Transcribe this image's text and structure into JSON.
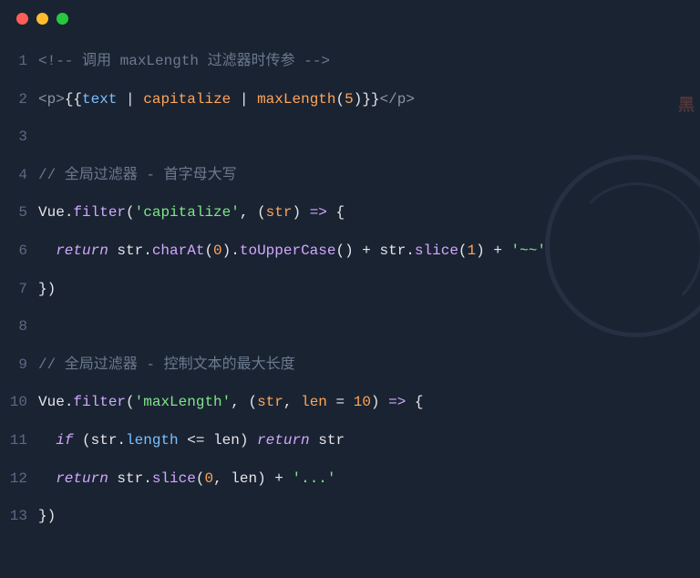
{
  "window": {
    "controls": [
      "close",
      "minimize",
      "maximize"
    ]
  },
  "code": {
    "lines": [
      {
        "n": "1",
        "tokens": [
          {
            "t": "comment",
            "v": "<!-- 调用 maxLength 过滤器时传参 -->"
          }
        ]
      },
      {
        "n": "2",
        "tokens": [
          {
            "t": "tag",
            "v": "<"
          },
          {
            "t": "tag",
            "v": "p"
          },
          {
            "t": "tag",
            "v": ">"
          },
          {
            "t": "white",
            "v": "{{"
          },
          {
            "t": "prop",
            "v": "text"
          },
          {
            "t": "white",
            "v": " | "
          },
          {
            "t": "filter",
            "v": "capitalize"
          },
          {
            "t": "white",
            "v": " | "
          },
          {
            "t": "filter",
            "v": "maxLength"
          },
          {
            "t": "white",
            "v": "("
          },
          {
            "t": "num",
            "v": "5"
          },
          {
            "t": "white",
            "v": ")"
          },
          {
            "t": "white",
            "v": "}}"
          },
          {
            "t": "tag",
            "v": "</"
          },
          {
            "t": "tag",
            "v": "p"
          },
          {
            "t": "tag",
            "v": ">"
          }
        ]
      },
      {
        "n": "3",
        "tokens": []
      },
      {
        "n": "4",
        "tokens": [
          {
            "t": "comment",
            "v": "// 全局过滤器 - 首字母大写"
          }
        ]
      },
      {
        "n": "5",
        "tokens": [
          {
            "t": "obj",
            "v": "Vue"
          },
          {
            "t": "punct",
            "v": "."
          },
          {
            "t": "method",
            "v": "filter"
          },
          {
            "t": "punct",
            "v": "("
          },
          {
            "t": "string",
            "v": "'capitalize'"
          },
          {
            "t": "punct",
            "v": ", ("
          },
          {
            "t": "yellow",
            "v": "str"
          },
          {
            "t": "punct",
            "v": ") "
          },
          {
            "t": "arrow",
            "v": "=>"
          },
          {
            "t": "punct",
            "v": " {"
          }
        ]
      },
      {
        "n": "6",
        "tokens": [
          {
            "t": "indent",
            "v": "  "
          },
          {
            "t": "return",
            "v": "return"
          },
          {
            "t": "var",
            "v": " str"
          },
          {
            "t": "punct",
            "v": "."
          },
          {
            "t": "method",
            "v": "charAt"
          },
          {
            "t": "punct",
            "v": "("
          },
          {
            "t": "num",
            "v": "0"
          },
          {
            "t": "punct",
            "v": ")."
          },
          {
            "t": "method",
            "v": "toUpperCase"
          },
          {
            "t": "punct",
            "v": "() + str."
          },
          {
            "t": "method",
            "v": "slice"
          },
          {
            "t": "punct",
            "v": "("
          },
          {
            "t": "num",
            "v": "1"
          },
          {
            "t": "punct",
            "v": ") + "
          },
          {
            "t": "string",
            "v": "'~~'"
          }
        ]
      },
      {
        "n": "7",
        "tokens": [
          {
            "t": "punct",
            "v": "})"
          }
        ]
      },
      {
        "n": "8",
        "tokens": []
      },
      {
        "n": "9",
        "tokens": [
          {
            "t": "comment",
            "v": "// 全局过滤器 - 控制文本的最大长度"
          }
        ]
      },
      {
        "n": "10",
        "tokens": [
          {
            "t": "obj",
            "v": "Vue"
          },
          {
            "t": "punct",
            "v": "."
          },
          {
            "t": "method",
            "v": "filter"
          },
          {
            "t": "punct",
            "v": "("
          },
          {
            "t": "string",
            "v": "'maxLength'"
          },
          {
            "t": "punct",
            "v": ", ("
          },
          {
            "t": "yellow",
            "v": "str"
          },
          {
            "t": "punct",
            "v": ", "
          },
          {
            "t": "yellow",
            "v": "len"
          },
          {
            "t": "punct",
            "v": " = "
          },
          {
            "t": "num",
            "v": "10"
          },
          {
            "t": "punct",
            "v": ") "
          },
          {
            "t": "arrow",
            "v": "=>"
          },
          {
            "t": "punct",
            "v": " {"
          }
        ]
      },
      {
        "n": "11",
        "tokens": [
          {
            "t": "indent",
            "v": "  "
          },
          {
            "t": "return",
            "v": "if"
          },
          {
            "t": "punct",
            "v": " (str."
          },
          {
            "t": "prop",
            "v": "length"
          },
          {
            "t": "punct",
            "v": " <= len) "
          },
          {
            "t": "return",
            "v": "return"
          },
          {
            "t": "var",
            "v": " str"
          }
        ]
      },
      {
        "n": "12",
        "tokens": [
          {
            "t": "indent",
            "v": "  "
          },
          {
            "t": "return",
            "v": "return"
          },
          {
            "t": "var",
            "v": " str"
          },
          {
            "t": "punct",
            "v": "."
          },
          {
            "t": "method",
            "v": "slice"
          },
          {
            "t": "punct",
            "v": "("
          },
          {
            "t": "num",
            "v": "0"
          },
          {
            "t": "punct",
            "v": ", len) + "
          },
          {
            "t": "string",
            "v": "'...'"
          }
        ]
      },
      {
        "n": "13",
        "tokens": [
          {
            "t": "punct",
            "v": "})"
          }
        ]
      }
    ]
  },
  "watermark": {
    "text": "黑"
  }
}
